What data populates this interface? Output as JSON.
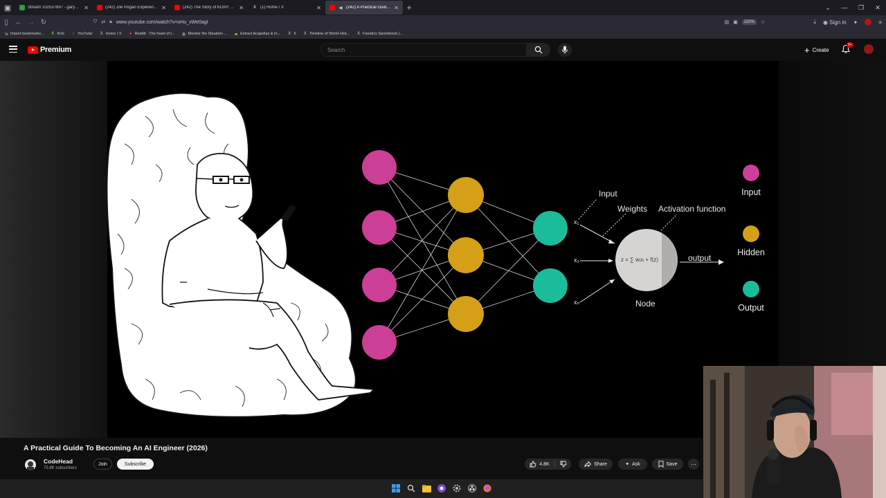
{
  "browser": {
    "tabs": [
      {
        "title": "Stream 102537897 - garydavis",
        "color": "#2e9e3f",
        "active": false
      },
      {
        "title": "(242) Joe Rogan Experience #1",
        "color": "#ff0000",
        "active": false
      },
      {
        "title": "(242) The Story of KONY 2012 |",
        "color": "#ff0000",
        "active": false
      },
      {
        "title": "(1) Home / X",
        "color": "#ffffff",
        "active": false
      },
      {
        "title": "(242) A Practical Guide To B",
        "color": "#ff0000",
        "active": true
      }
    ],
    "url": "www.youtube.com/watch?v=oHu_xWe0agI",
    "zoom": "110%",
    "sign_in": "Sign in",
    "bookmarks": [
      {
        "label": "Import bookmarks...",
        "icon": "import-icon"
      },
      {
        "label": "Kick",
        "icon": "kick-icon"
      },
      {
        "label": "YouTube",
        "icon": "youtube-icon"
      },
      {
        "label": "Home / X",
        "icon": "x-icon"
      },
      {
        "label": "Reddit - The heart of t...",
        "icon": "reddit-icon"
      },
      {
        "label": "Monitor the Situation ...",
        "icon": "monitor-icon"
      },
      {
        "label": "Extract Acapellas & In...",
        "icon": "folder-icon"
      },
      {
        "label": "X",
        "icon": "x-icon"
      },
      {
        "label": "Timeline of World Hist...",
        "icon": "x-icon"
      },
      {
        "label": "Fanatics Sportsbook (...",
        "icon": "x-icon"
      }
    ]
  },
  "youtube": {
    "brand": "Premium",
    "search_placeholder": "Search",
    "create_label": "Create",
    "notification_count": "9+"
  },
  "video_slide": {
    "diagram_labels": {
      "input": "Input",
      "weights": "Weights",
      "activation": "Activation function",
      "output": "output",
      "node": "Node",
      "formula": "z = ∑ wᵢxᵢ + f(z)",
      "x1": "x₁",
      "x2": "x₂",
      "xn": "xₙ"
    },
    "legend": [
      {
        "label": "Input",
        "color": "#cc3f96"
      },
      {
        "label": "Hidden",
        "color": "#d4a017"
      },
      {
        "label": "Output",
        "color": "#1abc9c"
      }
    ]
  },
  "video": {
    "title": "A Practical Guide To Becoming An AI Engineer (2026)",
    "channel": "CodeHead",
    "subscribers": "75.8K subscribers",
    "join_label": "Join",
    "subscribe_label": "Subscribe",
    "likes": "4.8K",
    "share_label": "Share",
    "ask_label": "Ask",
    "save_label": "Save"
  }
}
